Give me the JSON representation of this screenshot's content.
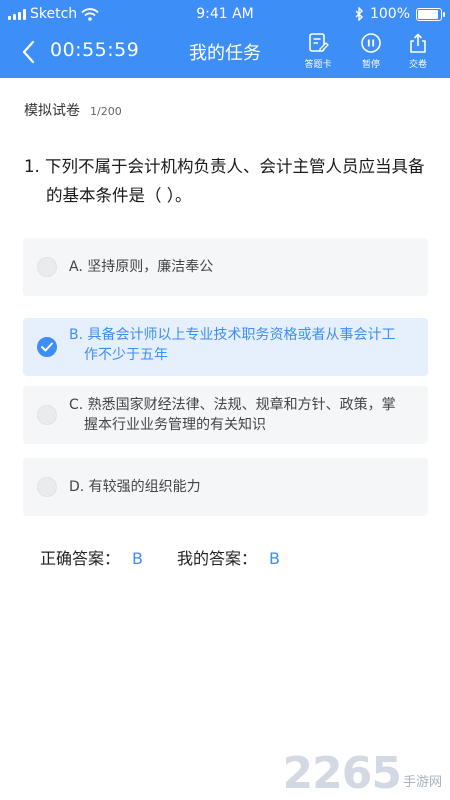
{
  "status_bar": {
    "carrier": "Sketch",
    "time": "9:41 AM",
    "battery": "100%"
  },
  "nav": {
    "timer": "00:55:59",
    "title": "我的任务",
    "answer_card_label": "答题卡",
    "pause_label": "暂停",
    "submit_label": "交卷"
  },
  "exam": {
    "title": "模拟试卷",
    "progress": "1/200"
  },
  "question": {
    "line1": "1. 下列不属于会计机构负责人、会计主管人员应当具备",
    "line2": "的基本条件是（   ）。",
    "options": [
      {
        "line1": "A. 坚持原则，廉洁奉公",
        "line2": "",
        "selected": false
      },
      {
        "line1": "B. 具备会计师以上专业技术职务资格或者从事会计工",
        "line2": "作不少于五年",
        "selected": true
      },
      {
        "line1": "C. 熟悉国家财经法律、法规、规章和方针、政策，掌",
        "line2": "握本行业业务管理的有关知识",
        "selected": false
      },
      {
        "line1": "D. 有较强的组织能力",
        "line2": "",
        "selected": false
      }
    ]
  },
  "answers": {
    "correct_label": "正确答案：",
    "correct_value": "B",
    "mine_label": "我的答案：",
    "mine_value": "B"
  },
  "watermark": {
    "number": "2265",
    "site": "手游网"
  },
  "colors": {
    "primary": "#3e8ef7",
    "option_bg": "#f4f6f8",
    "selected_bg": "#e6f0fd"
  },
  "icons": {
    "back": "chevron-left-icon",
    "answer_card": "answer-card-icon",
    "pause": "pause-icon",
    "submit": "share-upload-icon",
    "selected": "checkmark-icon"
  }
}
